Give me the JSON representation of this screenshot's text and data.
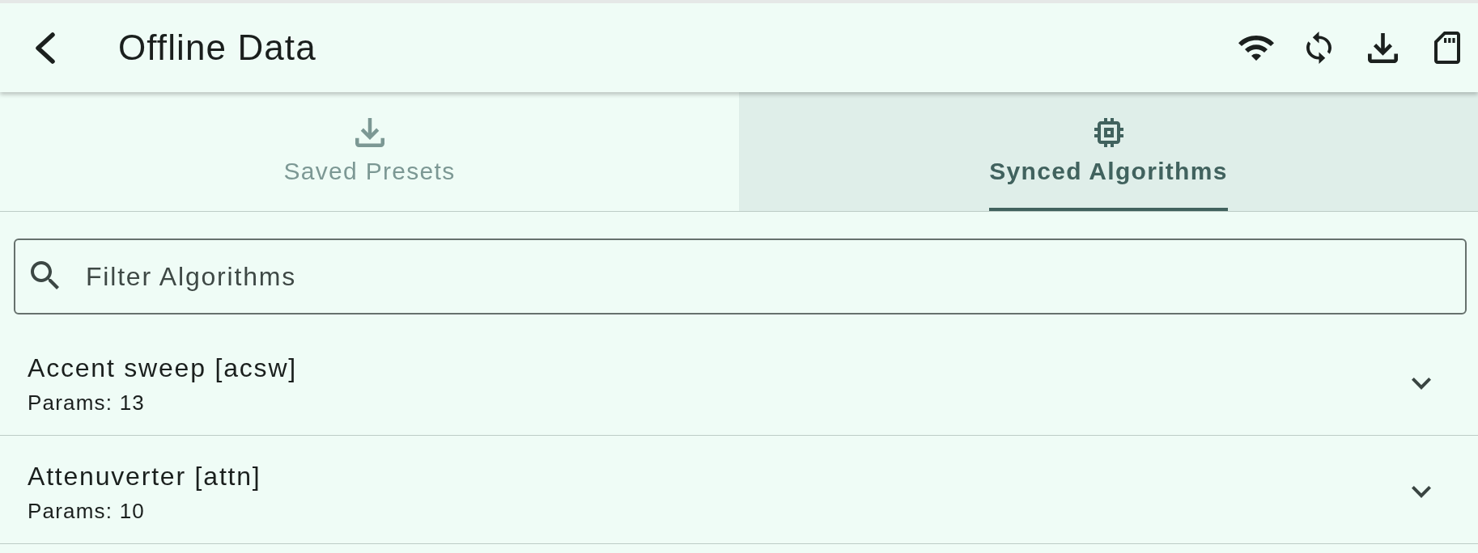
{
  "app_bar": {
    "title": "Offline Data"
  },
  "tabs": [
    {
      "label": "Saved Presets",
      "selected": false
    },
    {
      "label": "Synced Algorithms",
      "selected": true
    }
  ],
  "search": {
    "placeholder": "Filter Algorithms"
  },
  "algorithms": [
    {
      "name": "Accent sweep [acsw]",
      "params": "Params: 13",
      "expanded": false
    },
    {
      "name": "Attenuverter [attn]",
      "params": "Params: 10",
      "expanded": false
    }
  ]
}
